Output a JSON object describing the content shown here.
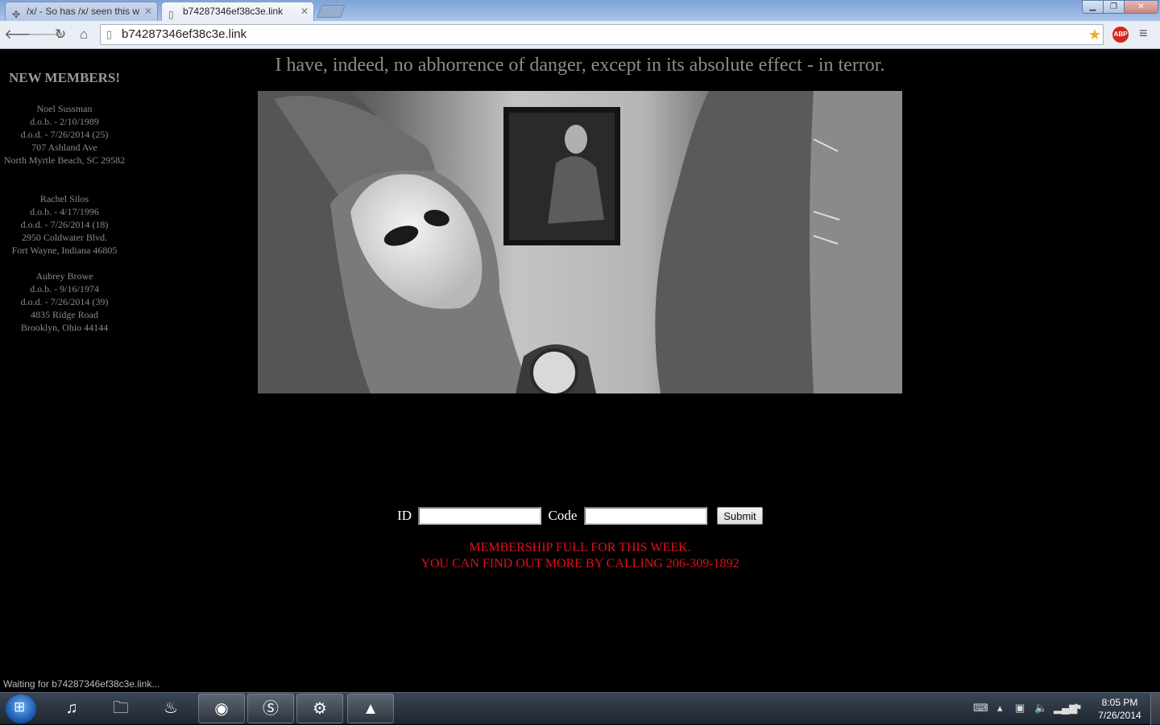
{
  "browser": {
    "tabs": [
      {
        "label": "/x/ - So has /x/ seen this w",
        "active": false
      },
      {
        "label": "b74287346ef38c3e.link",
        "active": true
      }
    ],
    "url": "b74287346ef38c3e.link",
    "status": "Waiting for b74287346ef38c3e.link...",
    "abp_label": "ABP"
  },
  "page": {
    "quote": "I have, indeed, no abhorrence of danger, except in its absolute effect - in terror.",
    "sidebar": {
      "title": "NEW MEMBERS!",
      "members": [
        {
          "name": "Noel Sussman",
          "dob": "d.o.b. - 2/10/1989",
          "dod": "d.o.d. - 7/26/2014 (25)",
          "street": "707 Ashland Ave",
          "city": "North Myrtle Beach, SC 29582"
        },
        {
          "name": "Rachel Silos",
          "dob": "d.o.b. - 4/17/1996",
          "dod": "d.o.d. - 7/26/2014 (18)",
          "street": "2950 Coldwater Blvd.",
          "city": "Fort Wayne, Indiana 46805"
        },
        {
          "name": "Aubrey Browe",
          "dob": "d.o.b. - 9/16/1974",
          "dod": "d.o.d. - 7/26/2014 (39)",
          "street": "4835 Ridge Road",
          "city": "Brooklyn, Ohio 44144"
        }
      ]
    },
    "form": {
      "id_label": "ID",
      "id_value": "",
      "code_label": "Code",
      "code_value": "",
      "submit_label": "Submit"
    },
    "notice": {
      "line1": "MEMBERSHIP FULL FOR THIS WEEK.",
      "line2": "YOU CAN FIND OUT MORE BY CALLING 206-309-1892"
    }
  },
  "taskbar": {
    "time": "8:05 PM",
    "date": "7/26/2014",
    "apps": [
      "itunes-icon",
      "explorer-icon",
      "flame-app-icon",
      "chrome-icon",
      "skype-icon",
      "steam-icon",
      "vlc-icon"
    ]
  },
  "colors": {
    "page_background": "#000000",
    "notice_red": "#e0101a",
    "quote_gray": "#8c8c8c",
    "sidebar_gray": "#8a8a8a"
  }
}
